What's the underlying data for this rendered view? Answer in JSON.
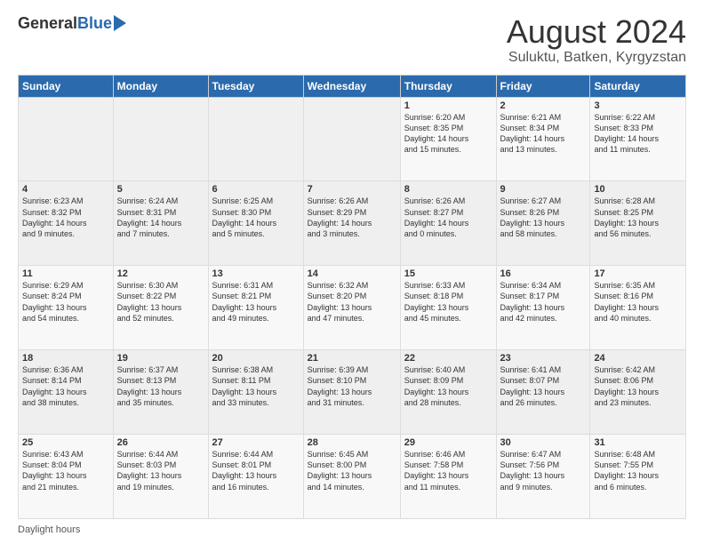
{
  "logo": {
    "general": "General",
    "blue": "Blue"
  },
  "header": {
    "month_year": "August 2024",
    "location": "Suluktu, Batken, Kyrgyzstan"
  },
  "days_of_week": [
    "Sunday",
    "Monday",
    "Tuesday",
    "Wednesday",
    "Thursday",
    "Friday",
    "Saturday"
  ],
  "footer": {
    "label": "Daylight hours"
  },
  "weeks": [
    [
      {
        "day": "",
        "info": ""
      },
      {
        "day": "",
        "info": ""
      },
      {
        "day": "",
        "info": ""
      },
      {
        "day": "",
        "info": ""
      },
      {
        "day": "1",
        "info": "Sunrise: 6:20 AM\nSunset: 8:35 PM\nDaylight: 14 hours\nand 15 minutes."
      },
      {
        "day": "2",
        "info": "Sunrise: 6:21 AM\nSunset: 8:34 PM\nDaylight: 14 hours\nand 13 minutes."
      },
      {
        "day": "3",
        "info": "Sunrise: 6:22 AM\nSunset: 8:33 PM\nDaylight: 14 hours\nand 11 minutes."
      }
    ],
    [
      {
        "day": "4",
        "info": "Sunrise: 6:23 AM\nSunset: 8:32 PM\nDaylight: 14 hours\nand 9 minutes."
      },
      {
        "day": "5",
        "info": "Sunrise: 6:24 AM\nSunset: 8:31 PM\nDaylight: 14 hours\nand 7 minutes."
      },
      {
        "day": "6",
        "info": "Sunrise: 6:25 AM\nSunset: 8:30 PM\nDaylight: 14 hours\nand 5 minutes."
      },
      {
        "day": "7",
        "info": "Sunrise: 6:26 AM\nSunset: 8:29 PM\nDaylight: 14 hours\nand 3 minutes."
      },
      {
        "day": "8",
        "info": "Sunrise: 6:26 AM\nSunset: 8:27 PM\nDaylight: 14 hours\nand 0 minutes."
      },
      {
        "day": "9",
        "info": "Sunrise: 6:27 AM\nSunset: 8:26 PM\nDaylight: 13 hours\nand 58 minutes."
      },
      {
        "day": "10",
        "info": "Sunrise: 6:28 AM\nSunset: 8:25 PM\nDaylight: 13 hours\nand 56 minutes."
      }
    ],
    [
      {
        "day": "11",
        "info": "Sunrise: 6:29 AM\nSunset: 8:24 PM\nDaylight: 13 hours\nand 54 minutes."
      },
      {
        "day": "12",
        "info": "Sunrise: 6:30 AM\nSunset: 8:22 PM\nDaylight: 13 hours\nand 52 minutes."
      },
      {
        "day": "13",
        "info": "Sunrise: 6:31 AM\nSunset: 8:21 PM\nDaylight: 13 hours\nand 49 minutes."
      },
      {
        "day": "14",
        "info": "Sunrise: 6:32 AM\nSunset: 8:20 PM\nDaylight: 13 hours\nand 47 minutes."
      },
      {
        "day": "15",
        "info": "Sunrise: 6:33 AM\nSunset: 8:18 PM\nDaylight: 13 hours\nand 45 minutes."
      },
      {
        "day": "16",
        "info": "Sunrise: 6:34 AM\nSunset: 8:17 PM\nDaylight: 13 hours\nand 42 minutes."
      },
      {
        "day": "17",
        "info": "Sunrise: 6:35 AM\nSunset: 8:16 PM\nDaylight: 13 hours\nand 40 minutes."
      }
    ],
    [
      {
        "day": "18",
        "info": "Sunrise: 6:36 AM\nSunset: 8:14 PM\nDaylight: 13 hours\nand 38 minutes."
      },
      {
        "day": "19",
        "info": "Sunrise: 6:37 AM\nSunset: 8:13 PM\nDaylight: 13 hours\nand 35 minutes."
      },
      {
        "day": "20",
        "info": "Sunrise: 6:38 AM\nSunset: 8:11 PM\nDaylight: 13 hours\nand 33 minutes."
      },
      {
        "day": "21",
        "info": "Sunrise: 6:39 AM\nSunset: 8:10 PM\nDaylight: 13 hours\nand 31 minutes."
      },
      {
        "day": "22",
        "info": "Sunrise: 6:40 AM\nSunset: 8:09 PM\nDaylight: 13 hours\nand 28 minutes."
      },
      {
        "day": "23",
        "info": "Sunrise: 6:41 AM\nSunset: 8:07 PM\nDaylight: 13 hours\nand 26 minutes."
      },
      {
        "day": "24",
        "info": "Sunrise: 6:42 AM\nSunset: 8:06 PM\nDaylight: 13 hours\nand 23 minutes."
      }
    ],
    [
      {
        "day": "25",
        "info": "Sunrise: 6:43 AM\nSunset: 8:04 PM\nDaylight: 13 hours\nand 21 minutes."
      },
      {
        "day": "26",
        "info": "Sunrise: 6:44 AM\nSunset: 8:03 PM\nDaylight: 13 hours\nand 19 minutes."
      },
      {
        "day": "27",
        "info": "Sunrise: 6:44 AM\nSunset: 8:01 PM\nDaylight: 13 hours\nand 16 minutes."
      },
      {
        "day": "28",
        "info": "Sunrise: 6:45 AM\nSunset: 8:00 PM\nDaylight: 13 hours\nand 14 minutes."
      },
      {
        "day": "29",
        "info": "Sunrise: 6:46 AM\nSunset: 7:58 PM\nDaylight: 13 hours\nand 11 minutes."
      },
      {
        "day": "30",
        "info": "Sunrise: 6:47 AM\nSunset: 7:56 PM\nDaylight: 13 hours\nand 9 minutes."
      },
      {
        "day": "31",
        "info": "Sunrise: 6:48 AM\nSunset: 7:55 PM\nDaylight: 13 hours\nand 6 minutes."
      }
    ]
  ]
}
